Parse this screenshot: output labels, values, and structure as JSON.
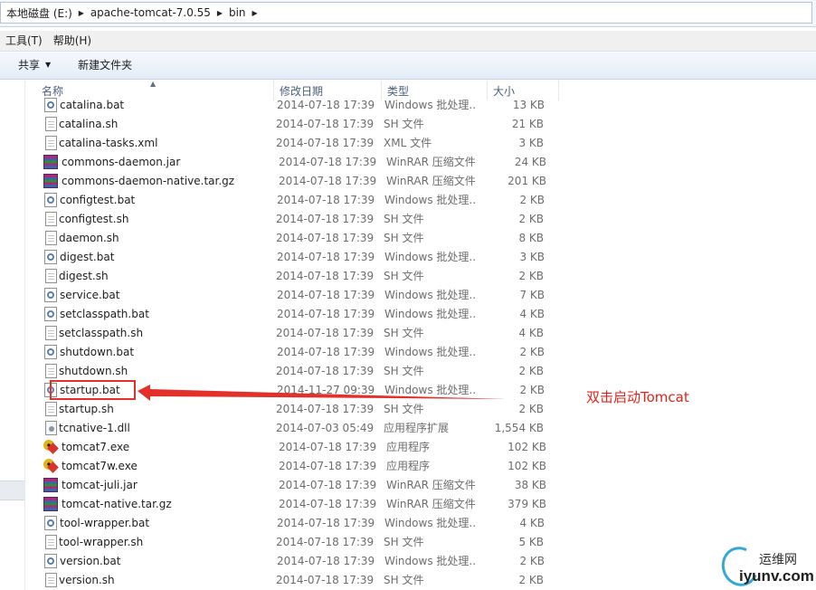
{
  "address": {
    "crumbs": [
      "本地磁盘 (E:)",
      "apache-tomcat-7.0.55",
      "bin"
    ]
  },
  "menu": {
    "tools": "工具(T)",
    "help": "帮助(H)"
  },
  "toolbar": {
    "share_label": "共享",
    "new_folder_label": "新建文件夹"
  },
  "columns": {
    "name": "名称",
    "date": "修改日期",
    "type": "类型",
    "size": "大小"
  },
  "files": [
    {
      "name": "catalina.bat",
      "date": "2014-07-18 17:39",
      "type": "Windows 批处理...",
      "size": "13 KB",
      "icon": "bat-icon"
    },
    {
      "name": "catalina.sh",
      "date": "2014-07-18 17:39",
      "type": "SH 文件",
      "size": "21 KB",
      "icon": "doc-icon"
    },
    {
      "name": "catalina-tasks.xml",
      "date": "2014-07-18 17:39",
      "type": "XML 文件",
      "size": "3 KB",
      "icon": "doc-icon"
    },
    {
      "name": "commons-daemon.jar",
      "date": "2014-07-18 17:39",
      "type": "WinRAR 压缩文件",
      "size": "24 KB",
      "icon": "rar-icon"
    },
    {
      "name": "commons-daemon-native.tar.gz",
      "date": "2014-07-18 17:39",
      "type": "WinRAR 压缩文件",
      "size": "201 KB",
      "icon": "rar-icon"
    },
    {
      "name": "configtest.bat",
      "date": "2014-07-18 17:39",
      "type": "Windows 批处理...",
      "size": "2 KB",
      "icon": "bat-icon"
    },
    {
      "name": "configtest.sh",
      "date": "2014-07-18 17:39",
      "type": "SH 文件",
      "size": "2 KB",
      "icon": "doc-icon"
    },
    {
      "name": "daemon.sh",
      "date": "2014-07-18 17:39",
      "type": "SH 文件",
      "size": "8 KB",
      "icon": "doc-icon"
    },
    {
      "name": "digest.bat",
      "date": "2014-07-18 17:39",
      "type": "Windows 批处理...",
      "size": "3 KB",
      "icon": "bat-icon"
    },
    {
      "name": "digest.sh",
      "date": "2014-07-18 17:39",
      "type": "SH 文件",
      "size": "2 KB",
      "icon": "doc-icon"
    },
    {
      "name": "service.bat",
      "date": "2014-07-18 17:39",
      "type": "Windows 批处理...",
      "size": "7 KB",
      "icon": "bat-icon"
    },
    {
      "name": "setclasspath.bat",
      "date": "2014-07-18 17:39",
      "type": "Windows 批处理...",
      "size": "4 KB",
      "icon": "bat-icon"
    },
    {
      "name": "setclasspath.sh",
      "date": "2014-07-18 17:39",
      "type": "SH 文件",
      "size": "4 KB",
      "icon": "doc-icon"
    },
    {
      "name": "shutdown.bat",
      "date": "2014-07-18 17:39",
      "type": "Windows 批处理...",
      "size": "2 KB",
      "icon": "bat-icon"
    },
    {
      "name": "shutdown.sh",
      "date": "2014-07-18 17:39",
      "type": "SH 文件",
      "size": "2 KB",
      "icon": "doc-icon"
    },
    {
      "name": "startup.bat",
      "date": "2014-11-27 09:39",
      "type": "Windows 批处理...",
      "size": "2 KB",
      "icon": "bat-icon"
    },
    {
      "name": "startup.sh",
      "date": "2014-07-18 17:39",
      "type": "SH 文件",
      "size": "2 KB",
      "icon": "doc-icon"
    },
    {
      "name": "tcnative-1.dll",
      "date": "2014-07-03 05:49",
      "type": "应用程序扩展",
      "size": "1,554 KB",
      "icon": "dll-icon"
    },
    {
      "name": "tomcat7.exe",
      "date": "2014-07-18 17:39",
      "type": "应用程序",
      "size": "102 KB",
      "icon": "exe-icon"
    },
    {
      "name": "tomcat7w.exe",
      "date": "2014-07-18 17:39",
      "type": "应用程序",
      "size": "102 KB",
      "icon": "exe-icon"
    },
    {
      "name": "tomcat-juli.jar",
      "date": "2014-07-18 17:39",
      "type": "WinRAR 压缩文件",
      "size": "38 KB",
      "icon": "rar-icon"
    },
    {
      "name": "tomcat-native.tar.gz",
      "date": "2014-07-18 17:39",
      "type": "WinRAR 压缩文件",
      "size": "379 KB",
      "icon": "rar-icon"
    },
    {
      "name": "tool-wrapper.bat",
      "date": "2014-07-18 17:39",
      "type": "Windows 批处理...",
      "size": "4 KB",
      "icon": "bat-icon"
    },
    {
      "name": "tool-wrapper.sh",
      "date": "2014-07-18 17:39",
      "type": "SH 文件",
      "size": "5 KB",
      "icon": "doc-icon"
    },
    {
      "name": "version.bat",
      "date": "2014-07-18 17:39",
      "type": "Windows 批处理...",
      "size": "2 KB",
      "icon": "bat-icon"
    },
    {
      "name": "version.sh",
      "date": "2014-07-18 17:39",
      "type": "SH 文件",
      "size": "2 KB",
      "icon": "doc-icon"
    }
  ],
  "annotation": {
    "text": "双击启动Tomcat",
    "color": "#e2231a"
  },
  "watermark": {
    "top": "运维网",
    "bottom": "iyunv.com"
  }
}
